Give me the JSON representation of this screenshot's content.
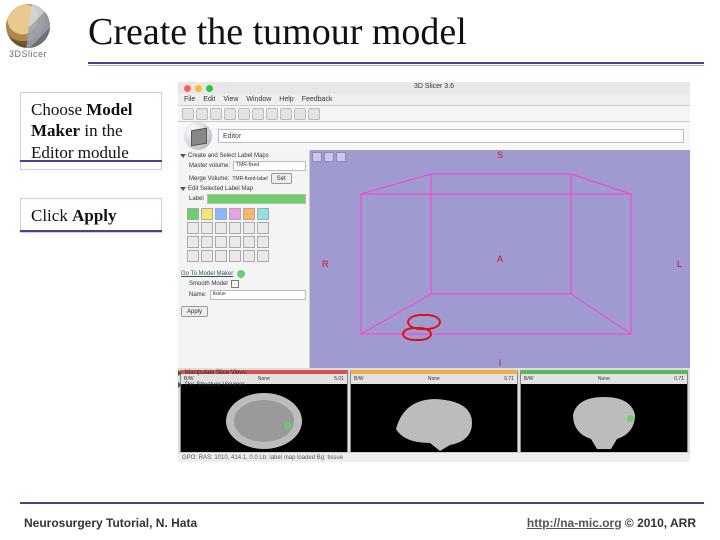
{
  "header": {
    "logo_caption": "3DSlicer",
    "title": "Create the tumour model"
  },
  "callouts": {
    "c1_pre": "Choose ",
    "c1_bold": "Model Maker",
    "c1_post": " in the Editor module",
    "c2_pre": "Click ",
    "c2_bold": "Apply"
  },
  "screenshot": {
    "window_title": "3D Slicer 3.6",
    "menu": [
      "File",
      "Edit",
      "View",
      "Window",
      "Help",
      "Feedback"
    ],
    "module_selector": "Editor",
    "panel": {
      "sec_create": "Create and Select Label Maps",
      "master_label": "Master volume:",
      "master_value": "TMR-fixed",
      "merge_label": "Merge Volume:",
      "merge_value": "TMR-fixed-label",
      "set_btn": "Set",
      "sec_edit": "Edit Selected Label Map",
      "label_label": "Label",
      "goto_label": "Go To Model Maker",
      "smooth_label": "Smooth Model",
      "name_label": "Name:",
      "name_value": "tissue",
      "apply_btn": "Apply",
      "manip_sec": "Manipulate Slice Views",
      "tool_sec": "Per-Structure Volumes"
    },
    "view3d": {
      "S": "S",
      "I": "I",
      "R": "R",
      "A": "A",
      "L": "L"
    },
    "slices": {
      "r_m": "B/W",
      "r_r": "None",
      "r_v": "5.01",
      "y_m": "B/W",
      "y_r": "None",
      "y_v": "0.71",
      "g_m": "B/W",
      "g_r": "None",
      "g_v": "0.71"
    },
    "status": "GPO: RAS: 1010, 414.1, 0.0  Lb: label map loaded  Bg: tissue"
  },
  "footer": {
    "left": "Neurosurgery Tutorial, N. Hata",
    "link": "http://na-mic.org",
    "right_post": " © 2010, ARR"
  }
}
